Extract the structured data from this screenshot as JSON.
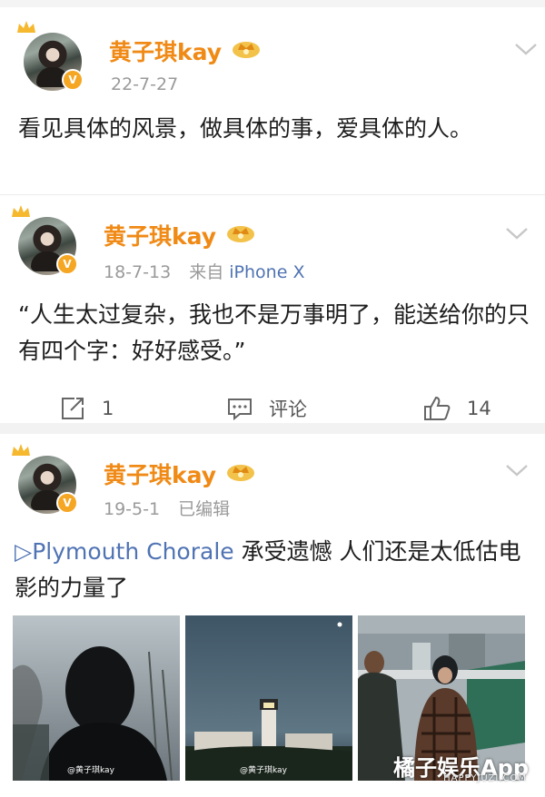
{
  "posts": [
    {
      "user": "黄子琪kay",
      "time": "22-7-27",
      "text": "看见具体的风景，做具体的事，爱具体的人。"
    },
    {
      "user": "黄子琪kay",
      "time": "18-7-13",
      "source_prefix": "来自",
      "source": "iPhone X",
      "text": "“人生太过复杂，我也不是万事明了，能送给你的只有四个字：好好感受。”",
      "repost_count": "1",
      "comment_label": "评论",
      "like_count": "14"
    },
    {
      "user": "黄子琪kay",
      "time": "19-5-1",
      "edited": "已编辑",
      "link": "▷Plymouth Chorale",
      "text": " 承受遗憾 人们还是太低估电影的力量了",
      "photo_watermarks": [
        "@黄子琪kay",
        "@黄子琪kay"
      ]
    }
  ],
  "watermark": {
    "brand": "橘子娱乐App",
    "url": "HAPPYJUZI.COM"
  },
  "colors": {
    "name": "#f08a16",
    "link": "#4f73b3",
    "meta": "#9a9a9a"
  }
}
